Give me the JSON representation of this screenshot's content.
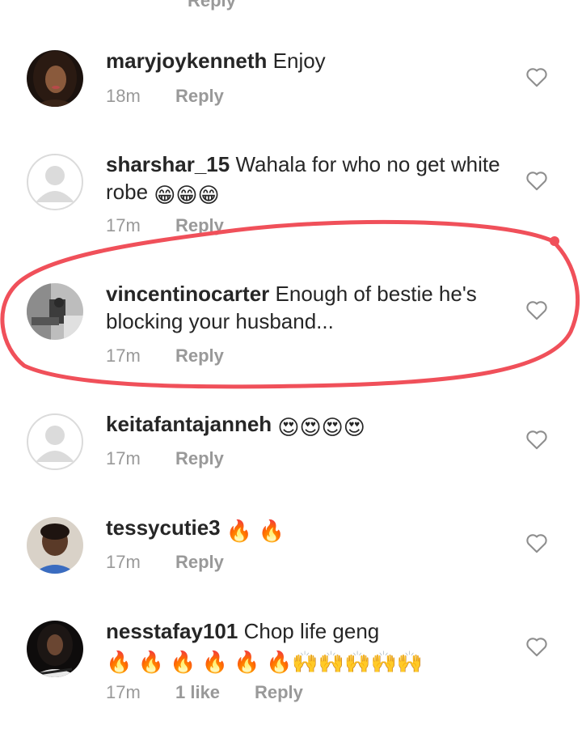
{
  "partial_top": {
    "reply_label": "Reply"
  },
  "comments": [
    {
      "username": "maryjoykenneth",
      "text": "Enjoy",
      "time": "18m",
      "likes": "",
      "reply_label": "Reply"
    },
    {
      "username": "sharshar_15",
      "text": "Wahala for who no get white robe",
      "emojis": "😁😁😁",
      "time": "17m",
      "likes": "",
      "reply_label": "Reply"
    },
    {
      "username": "vincentinocarter",
      "text": "Enough of bestie he's blocking your husband...",
      "time": "17m",
      "likes": "",
      "reply_label": "Reply"
    },
    {
      "username": "keitafantajanneh",
      "text": "",
      "emojis": "😍😍😍😍",
      "time": "17m",
      "likes": "",
      "reply_label": "Reply"
    },
    {
      "username": "tessycutie3",
      "text": "",
      "emojis": "🔥 🔥",
      "time": "17m",
      "likes": "",
      "reply_label": "Reply"
    },
    {
      "username": "nesstafay101",
      "text": "Chop life geng",
      "emojis": "🔥 🔥 🔥 🔥 🔥 🔥🙌🙌🙌🙌🙌",
      "time": "17m",
      "likes": "1 like",
      "reply_label": "Reply"
    }
  ],
  "icons": {
    "like": "heart-outline-icon",
    "default_avatar": "default-avatar-icon"
  },
  "colors": {
    "username": "#262626",
    "meta": "#999999",
    "highlight": "#f0505a"
  }
}
